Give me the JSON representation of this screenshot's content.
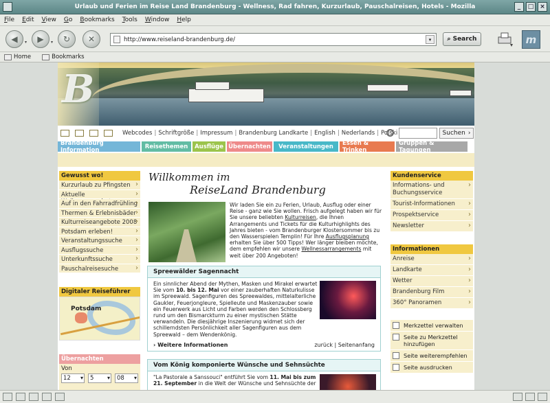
{
  "window": {
    "title": "Urlaub und Ferien im Reise Land Brandenburg - Wellness, Rad fahren, Kurzurlaub, Pauschalreisen, Hotels - Mozilla"
  },
  "menubar": [
    "File",
    "Edit",
    "View",
    "Go",
    "Bookmarks",
    "Tools",
    "Window",
    "Help"
  ],
  "navbar": {
    "url": "http://www.reiseland-brandenburg.de/",
    "search_label": "Search"
  },
  "personal_toolbar": {
    "home": "Home",
    "bookmarks": "Bookmarks"
  },
  "toplinks": [
    "Webcodes",
    "Schriftgröße",
    "Impressum",
    "Brandenburg Landkarte",
    "English",
    "Nederlands",
    "Polski"
  ],
  "site_search": {
    "button": "Suchen"
  },
  "navtabs": [
    {
      "label": "Brandenburg Information",
      "color": "#74b6d8"
    },
    {
      "label": "Reisethemen",
      "color": "#62bca4"
    },
    {
      "label": "Ausflüge",
      "color": "#9cc44c"
    },
    {
      "label": "Übernachten",
      "color": "#ee8a8a"
    },
    {
      "label": "Veranstaltungen",
      "color": "#48b8c8"
    },
    {
      "label": "Essen & Trinken",
      "color": "#e87a50"
    },
    {
      "label": "Gruppen & Tagungen",
      "color": "#a8a8a8"
    }
  ],
  "left": {
    "box1_title": "Gewusst wo!",
    "box1_items": [
      "Kurzurlaub zu Pfingsten",
      "Aktuelle Wellnessangebote",
      "Auf in den Fahrradfrühling",
      "Thermen & Erlebnisbäder",
      "Kulturreiseangebote 2008",
      "Potsdam erleben!",
      "Veranstaltungssuche",
      "Ausflugssuche",
      "Unterkunftssuche",
      "Pauschalreisesuche"
    ],
    "map_title": "Digitaler Reiseführer",
    "map_label": "Potsdam",
    "ueb_title": "Übernachten",
    "ueb_von": "Von",
    "ueb_day": "12",
    "ueb_month": "5",
    "ueb_year": "08"
  },
  "center": {
    "welcome_line1": "Willkommen im",
    "welcome_line2": "ReiseLand Brandenburg",
    "intro_1": "Wir laden Sie ein zu Ferien, Urlaub, Ausflug oder einer Reise - ganz wie Sie wollen. Frisch aufgelegt haben wir für Sie unsere beliebten ",
    "intro_link1": "Kulturreisen",
    "intro_2": ", die Ihnen Arrangements und Tickets für die Kulturhighlights des Jahres bieten - vom Brandenburger Klostersommer bis zu den Wasserspielen Templin! Für Ihre ",
    "intro_link2": "Ausflugsplanung",
    "intro_3": " erhalten Sie über 500 Tipps! Wer länger bleiben möchte, dem empfehlen wir unsere ",
    "intro_link3": "Wellnessarrangements",
    "intro_4": " mit weit über 200 Angeboten!",
    "article1": {
      "title": "Spreewälder Sagennacht",
      "text_1": "Ein sinnlicher Abend der Mythen, Masken und Mirakel erwartet Sie vom ",
      "text_bold": "10. bis 12. Mai",
      "text_2": " vor einer zauberhaften Naturkulisse im Spreewald. Sagenfiguren des Spreewaldes, mittelalterliche Gaukler, Feuerjongleure, Spielleute und Maskenzauber sowie ein Feuerwerk aus Licht und Farben werden den Schlossberg rund um den Bismarckturm zu einer mystischen Stätte verwandeln. Die diesjährige Inszenierung widmet sich der schillerndsten Persönlichkeit aller Sagenfiguren aus dem Spreewald – dem Wendenkönig.",
      "more": "Weitere Informationen",
      "back": "zurück",
      "top": "Seitenanfang"
    },
    "article2": {
      "title": "Vom König komponierte Wünsche und Sehnsüchte",
      "text_1": "\"La Pastorale a Sanssouci\" entführt Sie vom ",
      "text_bold": "11. Mai bis zum 21. September",
      "text_2": " in die Welt der Wünsche und Sehnsüchte der"
    }
  },
  "right": {
    "box1_title": "Kundenservice",
    "box1_items": [
      "Informations- und Buchungsservice",
      "Tourist-Informationen",
      "Prospektservice",
      "Newsletter"
    ],
    "box2_title": "Informationen",
    "box2_items": [
      "Anreise",
      "Landkarte",
      "Wetter",
      "Brandenburg Film",
      "360° Panoramen"
    ],
    "tools": [
      "Merkzettel verwalten",
      "Seite zu Merkzettel hinzufügen",
      "Seite weiterempfehlen",
      "Seite ausdrucken"
    ]
  }
}
